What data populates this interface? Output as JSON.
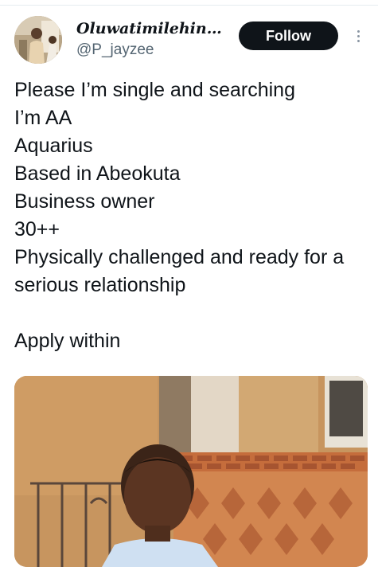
{
  "author": {
    "display_name": "Oluwatimilehin…",
    "handle": "@P_jayzee",
    "avatar_icon": "profile-photo"
  },
  "actions": {
    "follow_label": "Follow",
    "more_icon": "more-vertical-icon"
  },
  "tweet": {
    "lines": [
      "Please I’m single and searching",
      "I’m AA",
      "Aquarius",
      "Based in Abeokuta",
      "Business owner",
      "30++",
      "Physically challenged and ready for a serious relationship",
      "",
      "Apply within"
    ]
  },
  "media": {
    "type": "photo",
    "colors": {
      "wall": "#c7955f",
      "roof": "#d9cdbd",
      "brick": "#c8733f",
      "shirt": "#cfe0f2"
    }
  },
  "theme": {
    "follow_bg": "#0f1419",
    "secondary_text": "#536471"
  }
}
